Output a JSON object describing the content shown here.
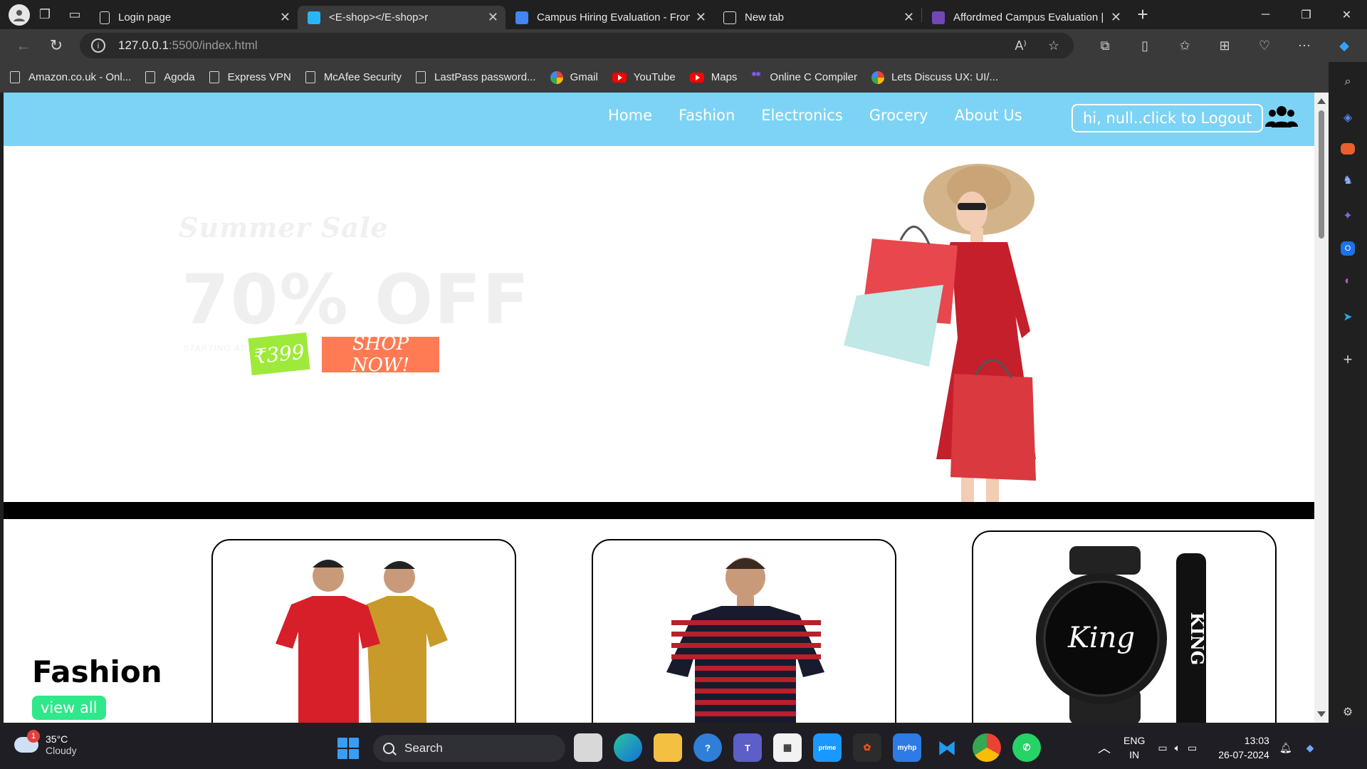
{
  "browser": {
    "tabs": [
      {
        "title": "Login page",
        "active": false
      },
      {
        "title": "<E-shop></E-shop>r",
        "active": true
      },
      {
        "title": "Campus Hiring Evaluation - Fron",
        "active": false
      },
      {
        "title": "New tab",
        "active": false
      },
      {
        "title": "Affordmed Campus Evaluation |",
        "active": false
      }
    ],
    "url_host": "127.0.0.1",
    "url_path": ":5500/index.html",
    "favorites": [
      {
        "label": "Amazon.co.uk - Onl...",
        "icon": "page-icon"
      },
      {
        "label": "Agoda",
        "icon": "page-icon"
      },
      {
        "label": "Express VPN",
        "icon": "page-icon"
      },
      {
        "label": "McAfee Security",
        "icon": "page-icon"
      },
      {
        "label": "LastPass password...",
        "icon": "page-icon"
      },
      {
        "label": "Gmail",
        "icon": "google-icon"
      },
      {
        "label": "YouTube",
        "icon": "youtube-icon"
      },
      {
        "label": "Maps",
        "icon": "youtube-icon"
      },
      {
        "label": "Online C Compiler",
        "icon": "compiler-icon"
      },
      {
        "label": "Lets Discuss UX: UI/...",
        "icon": "google-icon"
      }
    ]
  },
  "site": {
    "nav": [
      "Home",
      "Fashion",
      "Electronics",
      "Grocery",
      "About Us"
    ],
    "logout_label": "hi, null..click to Logout",
    "colors": {
      "nav_bg": "#7dd3f5",
      "shop_now_bg": "#ff7b54",
      "price_bg": "#9eea3b",
      "view_all_bg": "#2ee88a"
    }
  },
  "hero": {
    "sale_title": "Summer Sale",
    "discount": "70% OFF",
    "starting_at": "STARTING AT",
    "price": "₹399",
    "shop_now": "SHOP NOW!"
  },
  "fashion": {
    "title": "Fashion",
    "view_all": "view all",
    "cards": [
      {
        "product": "two-tshirts"
      },
      {
        "product": "striped-tshirt"
      },
      {
        "product": "king-watch",
        "watch_text": "King",
        "bracelet_text": "KING"
      }
    ]
  },
  "taskbar": {
    "weather_temp": "35°C",
    "weather_desc": "Cloudy",
    "weather_badge": "1",
    "search_label": "Search",
    "lang_top": "ENG",
    "lang_bottom": "IN",
    "time": "13:03",
    "date": "26-07-2024"
  }
}
